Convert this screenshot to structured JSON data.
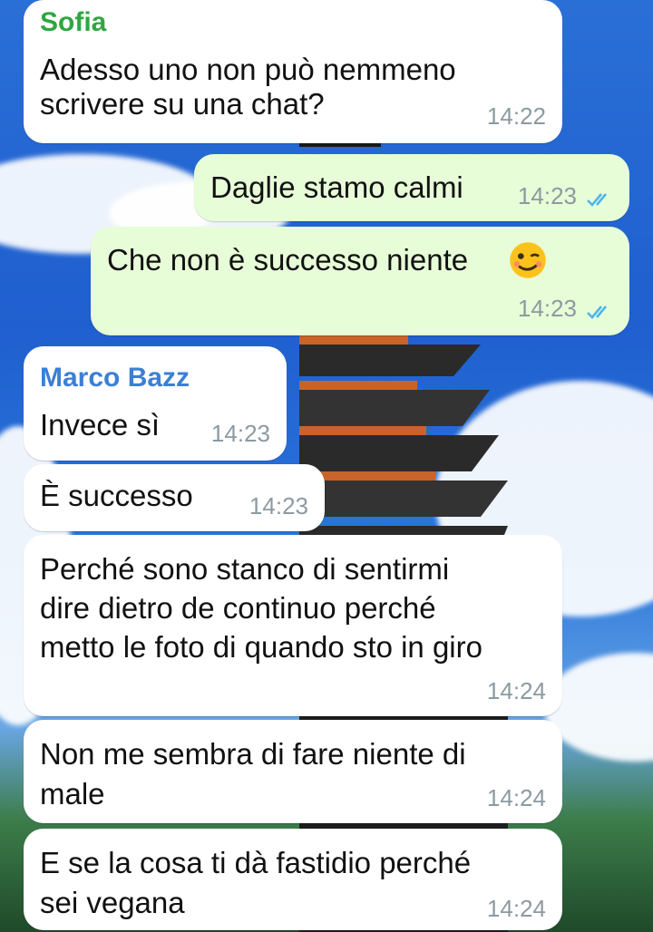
{
  "messages": [
    {
      "id": "m1",
      "direction": "incoming",
      "sender": "Sofia",
      "sender_color": "#2fa640",
      "text": "Adesso uno non può nemmeno\nscrivere su una chat?",
      "time": "14:22"
    },
    {
      "id": "m2",
      "direction": "outgoing",
      "text": "Daglie stamo calmi",
      "time": "14:23",
      "read": true
    },
    {
      "id": "m3",
      "direction": "outgoing",
      "text": "Che non è successo niente",
      "emoji": "winking-face",
      "time": "14:23",
      "read": true
    },
    {
      "id": "m4",
      "direction": "incoming",
      "sender": "Marco Bazz",
      "sender_color": "#3b7fd6",
      "text": "Invece sì",
      "time": "14:23"
    },
    {
      "id": "m5",
      "direction": "incoming",
      "text": "È successo",
      "time": "14:23"
    },
    {
      "id": "m6",
      "direction": "incoming",
      "text": "Perché sono stanco di sentirmi\ndire dietro de continuo perché\nmetto le foto di quando sto in giro",
      "time": "14:24"
    },
    {
      "id": "m7",
      "direction": "incoming",
      "text": "Non me sembra di fare niente di\nmale",
      "time": "14:24"
    },
    {
      "id": "m8",
      "direction": "incoming",
      "text": "E se la cosa ti dà fastidio perché\nsei vegana",
      "time": "14:24"
    }
  ],
  "colors": {
    "incoming_bubble": "#ffffff",
    "outgoing_bubble": "#e7fdd8",
    "read_ticks": "#4fb6ec",
    "timestamp": "#8c9aa1"
  }
}
